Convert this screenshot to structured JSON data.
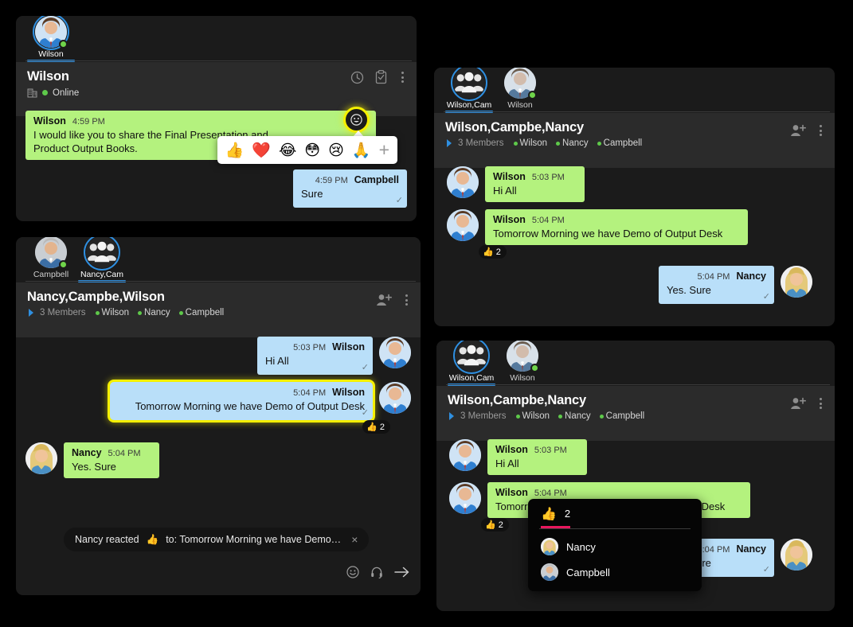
{
  "app": {
    "name": "Chat Client",
    "accent": "#2f8fe0",
    "highlight": "#f5f000",
    "bubble_incoming": "#b4f27e",
    "bubble_outgoing": "#b9dff9",
    "presence_online": "#6fd44a",
    "reaction_tab_underline": "#e8175d"
  },
  "panels": [
    {
      "id": "panel-one-to-one",
      "tabs": [
        {
          "label": "Wilson",
          "type": "person",
          "active": true,
          "presence": "online"
        }
      ],
      "header": {
        "title": "Wilson",
        "status": "Online",
        "org_icon": "building-icon"
      },
      "header_actions": [
        {
          "name": "history-clock-icon",
          "label": "History"
        },
        {
          "name": "clipboard-check-icon",
          "label": "Tasks"
        },
        {
          "name": "more-options-icon",
          "label": "More"
        }
      ],
      "messages": [
        {
          "sender": "Wilson",
          "time": "4:59 PM",
          "text": "I would like you to share the Final Presentation and Product Output Books.",
          "text_line1": "I would like you to share the Final Presentation and",
          "text_line2": "Product Output Books.",
          "side": "left",
          "color": "green",
          "read": false
        },
        {
          "sender": "Campbell",
          "time": "4:59 PM",
          "text": "Sure",
          "side": "right",
          "color": "blue",
          "read": true
        }
      ],
      "emoji_picker": {
        "emojis": [
          "👍",
          "❤️",
          "😂",
          "😳",
          "😢",
          "🙏"
        ],
        "add_label": "+",
        "trigger_icon": "emoji-reaction-icon"
      }
    },
    {
      "id": "panel-group-left",
      "tabs": [
        {
          "label": "Campbell",
          "type": "person",
          "active": false,
          "presence": "online"
        },
        {
          "label": "Nancy,Cam",
          "type": "group",
          "active": true
        }
      ],
      "header": {
        "title": "Nancy,Campbe,Wilson",
        "members_count": "3 Members",
        "members": [
          "Wilson",
          "Nancy",
          "Campbell"
        ]
      },
      "header_actions": [
        {
          "name": "add-member-icon",
          "label": "Add member"
        },
        {
          "name": "more-options-icon",
          "label": "More"
        }
      ],
      "messages": [
        {
          "sender": "Wilson",
          "time": "5:03 PM",
          "text": "Hi All",
          "side": "right",
          "color": "blue",
          "read": true
        },
        {
          "sender": "Wilson",
          "time": "5:04 PM",
          "text": "Tomorrow  Morning we have Demo of Output Desk",
          "side": "right",
          "color": "blue",
          "read": true,
          "highlighted": true,
          "reaction": {
            "emoji": "👍",
            "count": "2"
          }
        },
        {
          "sender": "Nancy",
          "time": "5:04 PM",
          "text": "Yes. Sure",
          "side": "left",
          "color": "green",
          "read": false
        }
      ],
      "toast": {
        "text_before": "Nancy reacted",
        "emoji": "👍",
        "text_after": "to: Tomorrow Morning we have Demo…",
        "close_label": "×"
      },
      "composer_actions": [
        {
          "name": "emoji-icon"
        },
        {
          "name": "headset-icon"
        },
        {
          "name": "send-icon"
        }
      ]
    },
    {
      "id": "panel-group-top-right",
      "tabs": [
        {
          "label": "Wilson,Cam",
          "type": "group",
          "active": true
        },
        {
          "label": "Wilson",
          "type": "person",
          "active": false,
          "presence": "online"
        }
      ],
      "header": {
        "title": "Wilson,Campbe,Nancy",
        "members_count": "3 Members",
        "members": [
          "Wilson",
          "Nancy",
          "Campbell"
        ]
      },
      "header_actions": [
        {
          "name": "add-member-icon",
          "label": "Add member"
        },
        {
          "name": "more-options-icon",
          "label": "More"
        }
      ],
      "messages": [
        {
          "sender": "Wilson",
          "time": "5:03 PM",
          "text": "Hi All",
          "side": "left",
          "color": "green",
          "read": false
        },
        {
          "sender": "Wilson",
          "time": "5:04 PM",
          "text": "Tomorrow  Morning we have Demo of Output Desk",
          "side": "left",
          "color": "green",
          "read": false,
          "reaction": {
            "emoji": "👍",
            "count": "2"
          }
        },
        {
          "sender": "Nancy",
          "time": "5:04 PM",
          "text": "Yes. Sure",
          "side": "right",
          "color": "blue",
          "read": true
        }
      ]
    },
    {
      "id": "panel-group-bottom-right",
      "tabs": [
        {
          "label": "Wilson,Cam",
          "type": "group",
          "active": true
        },
        {
          "label": "Wilson",
          "type": "person",
          "active": false,
          "presence": "online"
        }
      ],
      "header": {
        "title": "Wilson,Campbe,Nancy",
        "members_count": "3 Members",
        "members": [
          "Wilson",
          "Nancy",
          "Campbell"
        ]
      },
      "header_actions": [
        {
          "name": "add-member-icon",
          "label": "Add member"
        },
        {
          "name": "more-options-icon",
          "label": "More"
        }
      ],
      "messages": [
        {
          "sender": "Wilson",
          "time": "5:03 PM",
          "text": "Hi All",
          "side": "left",
          "color": "green",
          "read": false
        },
        {
          "sender": "Wilson",
          "time": "5:04 PM",
          "text": "Tomorrow  Morning we have Demo of Output Desk",
          "side": "left",
          "color": "green",
          "read": false,
          "reaction": {
            "emoji": "👍",
            "count": "2"
          }
        },
        {
          "sender": "Nancy",
          "time": "5:04 PM",
          "text": "Yes. Sure",
          "side": "right",
          "color": "blue",
          "read": true
        }
      ],
      "reaction_popup": {
        "tab_emoji": "👍",
        "tab_count": "2",
        "people": [
          {
            "name": "Nancy"
          },
          {
            "name": "Campbell"
          }
        ]
      }
    }
  ]
}
